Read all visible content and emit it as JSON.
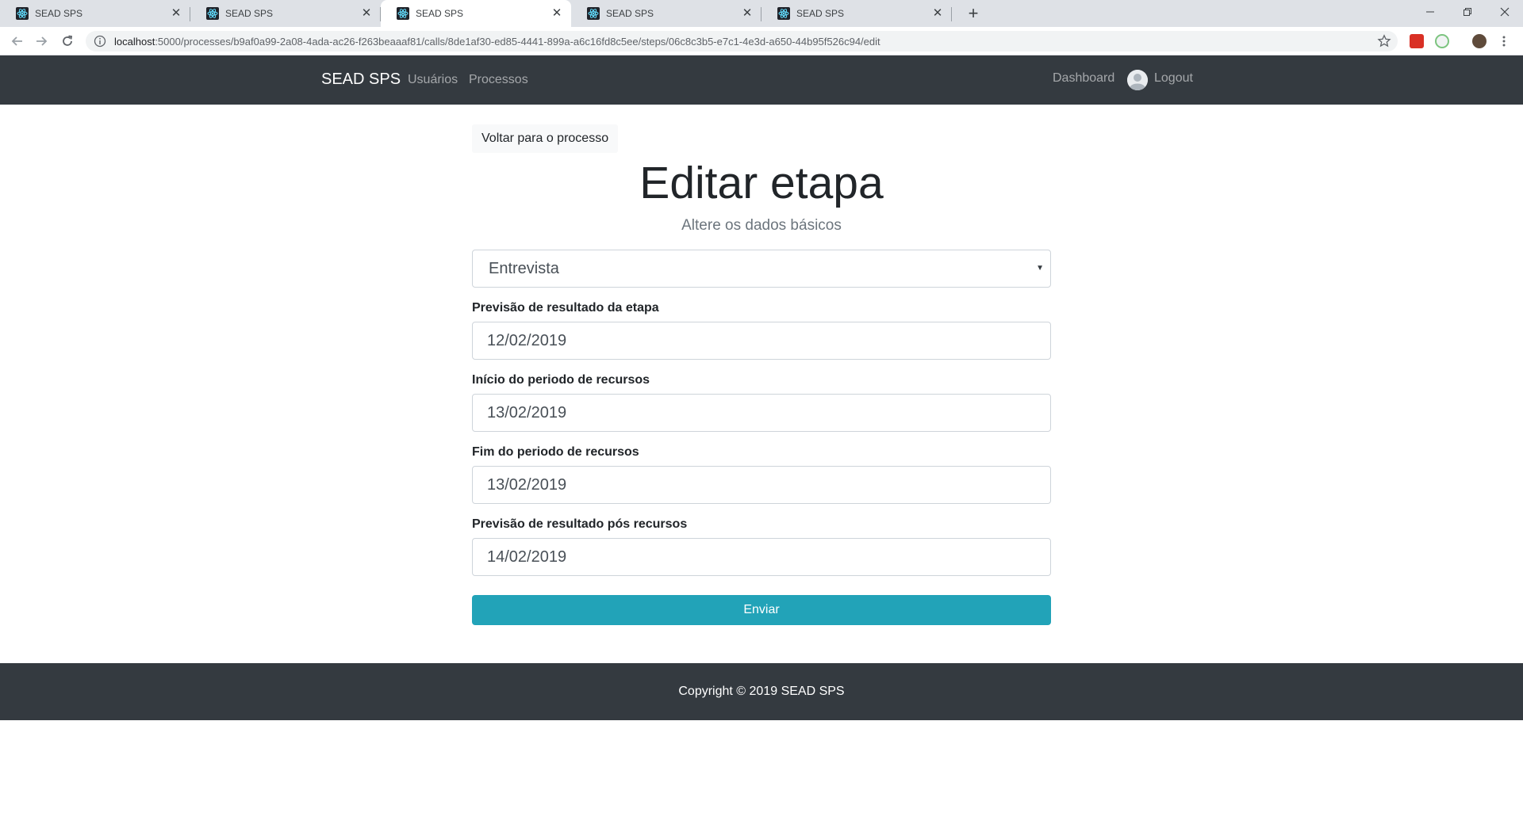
{
  "browser": {
    "tabs": [
      {
        "title": "SEAD SPS",
        "active": false
      },
      {
        "title": "SEAD SPS",
        "active": false
      },
      {
        "title": "SEAD SPS",
        "active": true
      },
      {
        "title": "SEAD SPS",
        "active": false
      },
      {
        "title": "SEAD SPS",
        "active": false
      }
    ],
    "url_host": "localhost",
    "url_path": ":5000/processes/b9af0a99-2a08-4ada-ac26-f263beaaaf81/calls/8de1af30-ed85-4441-899a-a6c16fd8c5ee/steps/06c8c3b5-e7c1-4e3d-a650-44b95f526c94/edit",
    "icons": {
      "favicon": "react-atom-icon",
      "back": "arrow-left-icon",
      "forward": "arrow-right-icon",
      "reload": "reload-icon",
      "site_info": "info-icon",
      "bookmark": "star-icon",
      "menu": "kebab-menu-icon"
    }
  },
  "navbar": {
    "brand": "SEAD SPS",
    "links": [
      "Usuários",
      "Processos"
    ],
    "right_links": {
      "dashboard": "Dashboard",
      "logout": "Logout"
    }
  },
  "form": {
    "back_label": "Voltar para o processo",
    "title": "Editar etapa",
    "subtitle": "Altere os dados básicos",
    "step_type": "Entrevista",
    "fields": [
      {
        "label": "Previsão de resultado da etapa",
        "value": "12/02/2019"
      },
      {
        "label": "Início do periodo de recursos",
        "value": "13/02/2019"
      },
      {
        "label": "Fim do periodo de recursos",
        "value": "13/02/2019"
      },
      {
        "label": "Previsão de resultado pós recursos",
        "value": "14/02/2019"
      }
    ],
    "submit_label": "Enviar"
  },
  "footer": {
    "text": "Copyright © 2019 SEAD SPS"
  },
  "colors": {
    "navbar_bg": "#343a40",
    "submit_bg": "#22a3b8",
    "tabstrip_bg": "#dee1e6"
  }
}
